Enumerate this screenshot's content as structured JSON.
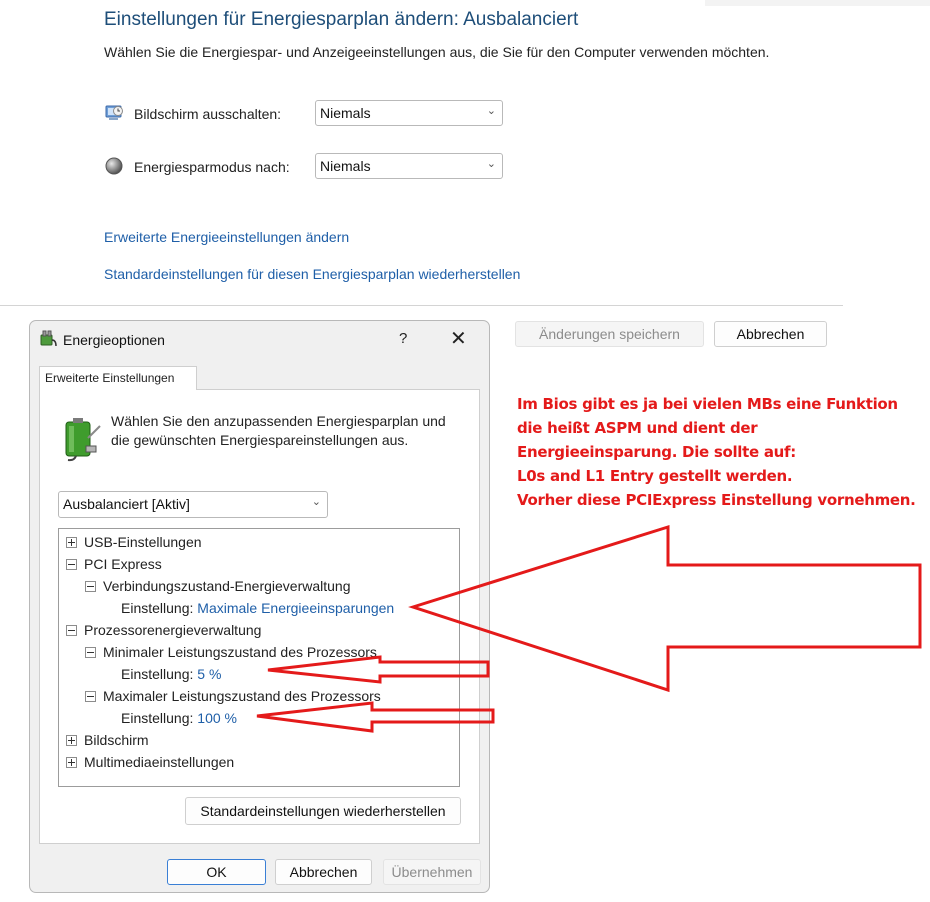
{
  "page": {
    "title": "Einstellungen für Energiesparplan ändern: Ausbalanciert",
    "subtitle": "Wählen Sie die Energiespar- und Anzeigeeinstellungen aus, die Sie für den Computer verwenden möchten.",
    "display_off_label": "Bildschirm ausschalten:",
    "display_off_value": "Niemals",
    "sleep_label": "Energiesparmodus nach:",
    "sleep_value": "Niemals",
    "advanced_link": "Erweiterte Energieeinstellungen ändern",
    "restore_link": "Standardeinstellungen für diesen Energiesparplan wiederherstellen",
    "save_button": "Änderungen speichern",
    "cancel_button": "Abbrechen"
  },
  "dialog": {
    "title": "Energieoptionen",
    "help": "?",
    "close": "✕",
    "tab": "Erweiterte Einstellungen",
    "intro": "Wählen Sie den anzupassenden Energiesparplan und die gewünschten Energiespareinstellungen aus.",
    "plan_select": "Ausbalanciert [Aktiv]",
    "tree": {
      "usb": "USB-Einstellungen",
      "pci": "PCI Express",
      "link_state": "Verbindungszustand-Energieverwaltung",
      "setting_label": "Einstellung:",
      "link_state_value": "Maximale Energieeinsparungen",
      "cpu": "Prozessorenergieverwaltung",
      "min_state": "Minimaler Leistungszustand des Prozessors",
      "min_state_value": "5 %",
      "max_state": "Maximaler Leistungszustand des Prozessors",
      "max_state_value": "100 %",
      "display": "Bildschirm",
      "multimedia": "Multimediaeinstellungen"
    },
    "restore_defaults": "Standardeinstellungen wiederherstellen",
    "ok": "OK",
    "cancel": "Abbrechen",
    "apply": "Übernehmen"
  },
  "annotation": {
    "lines": [
      "Im Bios gibt es ja bei vielen MBs eine Funktion",
      "die heißt ASPM und dient der",
      "Energieeinsparung. Die sollte auf:",
      "L0s and L1 Entry gestellt werden.",
      "Vorher diese PCIExpress Einstellung vornehmen."
    ]
  },
  "colors": {
    "title_blue": "#1e4e79",
    "link_blue": "#1f5fa8",
    "annotation_red": "#e41a1a"
  }
}
